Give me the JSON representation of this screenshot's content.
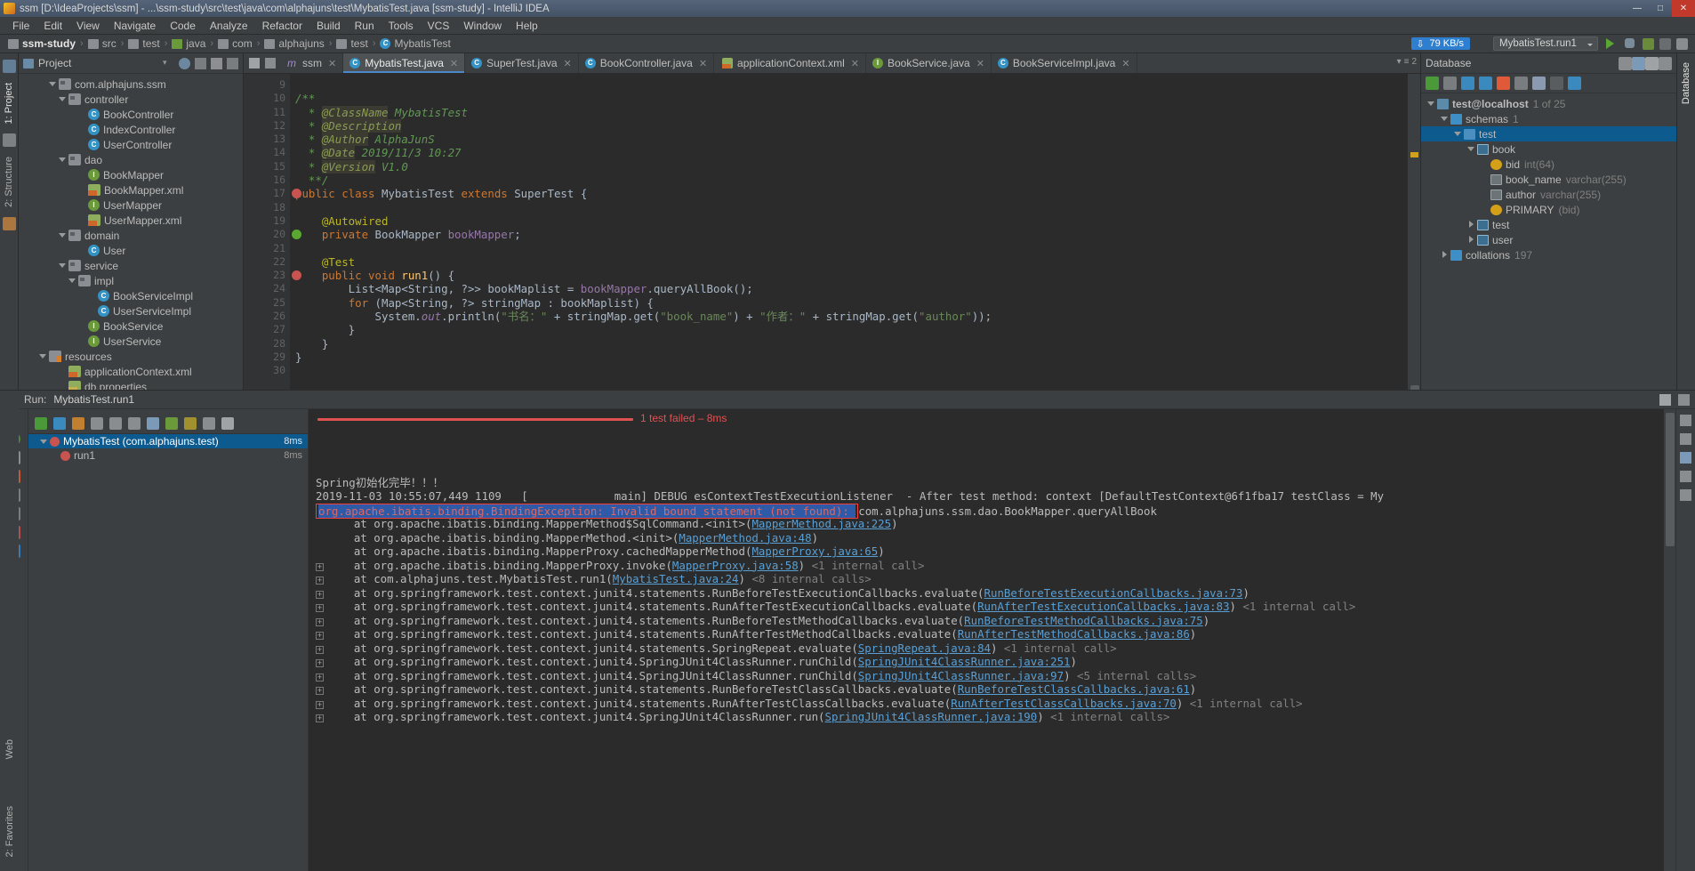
{
  "window": {
    "title": "ssm [D:\\IdeaProjects\\ssm] - ...\\ssm-study\\src\\test\\java\\com\\alphajuns\\test\\MybatisTest.java [ssm-study] - IntelliJ IDEA",
    "minimize": "—",
    "maximize": "□",
    "close": "✕"
  },
  "menubar": {
    "items": [
      "File",
      "Edit",
      "View",
      "Navigate",
      "Code",
      "Analyze",
      "Refactor",
      "Build",
      "Run",
      "Tools",
      "VCS",
      "Window",
      "Help"
    ]
  },
  "breadcrumb": {
    "items": [
      {
        "label": "ssm-study",
        "icon": "module-icon"
      },
      {
        "label": "src",
        "icon": "folder-icon"
      },
      {
        "label": "test",
        "icon": "folder-icon"
      },
      {
        "label": "java",
        "icon": "source-folder-icon"
      },
      {
        "label": "com",
        "icon": "package-icon"
      },
      {
        "label": "alphajuns",
        "icon": "package-icon"
      },
      {
        "label": "test",
        "icon": "package-icon"
      },
      {
        "label": "MybatisTest",
        "icon": "class-icon"
      }
    ]
  },
  "toolbar_right": {
    "network_badge": "79 KB/s",
    "run_config": "MybatisTest.run1"
  },
  "left_strip": {
    "tabs": [
      "1: Project",
      "2: Structure"
    ],
    "bottom_tabs": [
      "Web",
      "2: Favorites"
    ]
  },
  "right_strip": {
    "tabs": [
      "Database"
    ]
  },
  "project_panel": {
    "title": "Project",
    "tree": [
      {
        "label": "com.alphajuns.ssm",
        "indent": 3,
        "arrow": "down",
        "icon": "package-icon"
      },
      {
        "label": "controller",
        "indent": 4,
        "arrow": "down",
        "icon": "package-icon"
      },
      {
        "label": "BookController",
        "indent": 6,
        "arrow": "none",
        "icon": "class-icon"
      },
      {
        "label": "IndexController",
        "indent": 6,
        "arrow": "none",
        "icon": "class-icon"
      },
      {
        "label": "UserController",
        "indent": 6,
        "arrow": "none",
        "icon": "class-icon"
      },
      {
        "label": "dao",
        "indent": 4,
        "arrow": "down",
        "icon": "package-icon"
      },
      {
        "label": "BookMapper",
        "indent": 6,
        "arrow": "none",
        "icon": "interface-icon"
      },
      {
        "label": "BookMapper.xml",
        "indent": 6,
        "arrow": "none",
        "icon": "xml-icon"
      },
      {
        "label": "UserMapper",
        "indent": 6,
        "arrow": "none",
        "icon": "interface-icon"
      },
      {
        "label": "UserMapper.xml",
        "indent": 6,
        "arrow": "none",
        "icon": "xml-icon"
      },
      {
        "label": "domain",
        "indent": 4,
        "arrow": "down",
        "icon": "package-icon"
      },
      {
        "label": "User",
        "indent": 6,
        "arrow": "none",
        "icon": "class-icon"
      },
      {
        "label": "service",
        "indent": 4,
        "arrow": "down",
        "icon": "package-icon"
      },
      {
        "label": "impl",
        "indent": 5,
        "arrow": "down",
        "icon": "package-icon"
      },
      {
        "label": "BookServiceImpl",
        "indent": 7,
        "arrow": "none",
        "icon": "class-icon"
      },
      {
        "label": "UserServiceImpl",
        "indent": 7,
        "arrow": "none",
        "icon": "class-icon"
      },
      {
        "label": "BookService",
        "indent": 6,
        "arrow": "none",
        "icon": "interface-icon"
      },
      {
        "label": "UserService",
        "indent": 6,
        "arrow": "none",
        "icon": "interface-icon"
      },
      {
        "label": "resources",
        "indent": 2,
        "arrow": "down",
        "icon": "resource-folder-icon"
      },
      {
        "label": "applicationContext.xml",
        "indent": 4,
        "arrow": "none",
        "icon": "xml-icon"
      },
      {
        "label": "db.properties",
        "indent": 4,
        "arrow": "none",
        "icon": "properties-icon"
      }
    ]
  },
  "editor": {
    "tabs": [
      {
        "label": "ssm",
        "icon": "module-icon",
        "active": false,
        "closable": true
      },
      {
        "label": "MybatisTest.java",
        "icon": "class-icon",
        "active": true,
        "closable": true
      },
      {
        "label": "SuperTest.java",
        "icon": "class-icon",
        "active": false,
        "closable": true
      },
      {
        "label": "BookController.java",
        "icon": "class-icon",
        "active": false,
        "closable": true
      },
      {
        "label": "applicationContext.xml",
        "icon": "xml-icon",
        "active": false,
        "closable": true
      },
      {
        "label": "BookService.java",
        "icon": "interface-icon",
        "active": false,
        "closable": true
      },
      {
        "label": "BookServiceImpl.java",
        "icon": "class-icon",
        "active": false,
        "closable": true
      }
    ],
    "tab_overflow_count": "2",
    "line_numbers": [
      "9",
      "10",
      "11",
      "12",
      "13",
      "14",
      "15",
      "16",
      "17",
      "18",
      "19",
      "20",
      "21",
      "22",
      "23",
      "24",
      "25",
      "26",
      "27",
      "28",
      "29",
      "30"
    ],
    "code_lines": [
      {
        "n": "9",
        "html": ""
      },
      {
        "n": "10",
        "html": "<span class=\"cm\">/**</span>"
      },
      {
        "n": "11",
        "html": "  <span class=\"cm\">* </span><span class=\"tag\">@ClassName</span><span class=\"cm\"> MybatisTest</span>"
      },
      {
        "n": "12",
        "html": "  <span class=\"cm\">* </span><span class=\"tag\">@Description</span>"
      },
      {
        "n": "13",
        "html": "  <span class=\"cm\">* </span><span class=\"tag\">@Author</span><span class=\"cm\"> AlphaJunS</span>"
      },
      {
        "n": "14",
        "html": "  <span class=\"cm\">* </span><span class=\"tag\">@Date</span><span class=\"cm\"> 2019/11/3 10:27</span>"
      },
      {
        "n": "15",
        "html": "  <span class=\"cm\">* </span><span class=\"tag\">@Version</span><span class=\"cm\"> V1.0</span>"
      },
      {
        "n": "16",
        "html": "  <span class=\"cm\">**/</span>"
      },
      {
        "n": "17",
        "html": "<span class=\"kw\">public class </span>MybatisTest <span class=\"kw\">extends </span>SuperTest <span class=\"brc\">{</span>"
      },
      {
        "n": "18",
        "html": ""
      },
      {
        "n": "19",
        "html": "    <span class=\"an\">@Autowired</span>"
      },
      {
        "n": "20",
        "html": "    <span class=\"kw\">private </span>BookMapper <span class=\"fld\">bookMapper</span>;"
      },
      {
        "n": "21",
        "html": ""
      },
      {
        "n": "22",
        "html": "    <span class=\"an\">@Test</span>"
      },
      {
        "n": "23",
        "html": "    <span class=\"kw\">public void </span><span class=\"mth\">run1</span>() {"
      },
      {
        "n": "24",
        "html": "        List&lt;Map&lt;String, ?&gt;&gt; bookMaplist = <span class=\"fld\">bookMapper</span>.queryAllBook();"
      },
      {
        "n": "25",
        "html": "        <span class=\"kw\">for </span>(Map&lt;String, ?&gt; stringMap : bookMaplist) {"
      },
      {
        "n": "26",
        "html": "            System.<span class=\"stat\">out</span>.println(<span class=\"str\">\"书名：\"</span> + stringMap.get(<span class=\"str\">\"book_name\"</span>) + <span class=\"str\">\"作者：\"</span> + stringMap.get(<span class=\"str\">\"author\"</span>));"
      },
      {
        "n": "27",
        "html": "        }"
      },
      {
        "n": "28",
        "html": "    }"
      },
      {
        "n": "29",
        "html": "<span class=\"brc\">}</span>"
      },
      {
        "n": "30",
        "html": ""
      }
    ],
    "status_breadcrumb": "MybatisTest"
  },
  "database_panel": {
    "title": "Database",
    "tree": [
      {
        "label": "test@localhost",
        "suffix": "1 of 25",
        "indent": 0,
        "arrow": "down",
        "icon": "datasource-icon",
        "bold": true
      },
      {
        "label": "schemas",
        "suffix": "1",
        "indent": 1,
        "arrow": "down",
        "icon": "folder-icon"
      },
      {
        "label": "test",
        "suffix": "",
        "indent": 2,
        "arrow": "down",
        "icon": "schema-icon",
        "selected": true
      },
      {
        "label": "book",
        "suffix": "",
        "indent": 3,
        "arrow": "down",
        "icon": "table-icon"
      },
      {
        "label": "bid",
        "suffix": "int(64)",
        "indent": 4,
        "arrow": "none",
        "icon": "key-column-icon"
      },
      {
        "label": "book_name",
        "suffix": "varchar(255)",
        "indent": 4,
        "arrow": "none",
        "icon": "column-icon"
      },
      {
        "label": "author",
        "suffix": "varchar(255)",
        "indent": 4,
        "arrow": "none",
        "icon": "column-icon"
      },
      {
        "label": "PRIMARY",
        "suffix": "(bid)",
        "indent": 4,
        "arrow": "none",
        "icon": "primary-key-icon"
      },
      {
        "label": "test",
        "suffix": "",
        "indent": 3,
        "arrow": "right",
        "icon": "table-icon"
      },
      {
        "label": "user",
        "suffix": "",
        "indent": 3,
        "arrow": "right",
        "icon": "table-icon"
      },
      {
        "label": "collations",
        "suffix": "197",
        "indent": 1,
        "arrow": "right",
        "icon": "folder-icon"
      }
    ]
  },
  "run_panel": {
    "title": "Run:",
    "config_name": "MybatisTest.run1",
    "test_tree": [
      {
        "label": "MybatisTest (com.alphajuns.test)",
        "time": "8ms",
        "indent": 1,
        "status": "fail",
        "selected": true,
        "arrow": "down"
      },
      {
        "label": "run1",
        "time": "8ms",
        "indent": 3,
        "status": "fail",
        "selected": false,
        "arrow": "none"
      }
    ],
    "progress_text": "1 test failed – 8ms",
    "console_lines": [
      {
        "type": "plain",
        "text": "Spring初始化完毕！！！"
      },
      {
        "type": "plain",
        "text": "2019-11-03 10:55:07,449 1109   [             main] DEBUG esContextTestExecutionListener  - After test method: context [DefaultTestContext@6f1fba17 testClass = My"
      },
      {
        "type": "error-highlight",
        "text": "org.apache.ibatis.binding.BindingException: Invalid bound statement (not found): ",
        "tail": "com.alphajuns.ssm.dao.BookMapper.queryAllBook"
      },
      {
        "type": "stack",
        "expand": false,
        "pre": "    at org.apache.ibatis.binding.MapperMethod$SqlCommand.<init>(",
        "link": "MapperMethod.java:225",
        "post": ")",
        "note": ""
      },
      {
        "type": "stack",
        "expand": false,
        "pre": "    at org.apache.ibatis.binding.MapperMethod.<init>(",
        "link": "MapperMethod.java:48",
        "post": ")",
        "note": ""
      },
      {
        "type": "stack",
        "expand": false,
        "pre": "    at org.apache.ibatis.binding.MapperProxy.cachedMapperMethod(",
        "link": "MapperProxy.java:65",
        "post": ")",
        "note": ""
      },
      {
        "type": "stack",
        "expand": true,
        "pre": "    at org.apache.ibatis.binding.MapperProxy.invoke(",
        "link": "MapperProxy.java:58",
        "post": ")",
        "note": "<1 internal call>"
      },
      {
        "type": "stack",
        "expand": true,
        "pre": "    at com.alphajuns.test.MybatisTest.run1(",
        "link": "MybatisTest.java:24",
        "post": ")",
        "note": "<8 internal calls>"
      },
      {
        "type": "stack",
        "expand": true,
        "pre": "    at org.springframework.test.context.junit4.statements.RunBeforeTestExecutionCallbacks.evaluate(",
        "link": "RunBeforeTestExecutionCallbacks.java:73",
        "post": ")",
        "note": ""
      },
      {
        "type": "stack",
        "expand": true,
        "pre": "    at org.springframework.test.context.junit4.statements.RunAfterTestExecutionCallbacks.evaluate(",
        "link": "RunAfterTestExecutionCallbacks.java:83",
        "post": ")",
        "note": "<1 internal call>"
      },
      {
        "type": "stack",
        "expand": true,
        "pre": "    at org.springframework.test.context.junit4.statements.RunBeforeTestMethodCallbacks.evaluate(",
        "link": "RunBeforeTestMethodCallbacks.java:75",
        "post": ")",
        "note": ""
      },
      {
        "type": "stack",
        "expand": true,
        "pre": "    at org.springframework.test.context.junit4.statements.RunAfterTestMethodCallbacks.evaluate(",
        "link": "RunAfterTestMethodCallbacks.java:86",
        "post": ")",
        "note": ""
      },
      {
        "type": "stack",
        "expand": true,
        "pre": "    at org.springframework.test.context.junit4.statements.SpringRepeat.evaluate(",
        "link": "SpringRepeat.java:84",
        "post": ")",
        "note": "<1 internal call>"
      },
      {
        "type": "stack",
        "expand": true,
        "pre": "    at org.springframework.test.context.junit4.SpringJUnit4ClassRunner.runChild(",
        "link": "SpringJUnit4ClassRunner.java:251",
        "post": ")",
        "note": ""
      },
      {
        "type": "stack",
        "expand": true,
        "pre": "    at org.springframework.test.context.junit4.SpringJUnit4ClassRunner.runChild(",
        "link": "SpringJUnit4ClassRunner.java:97",
        "post": ")",
        "note": "<5 internal calls>"
      },
      {
        "type": "stack",
        "expand": true,
        "pre": "    at org.springframework.test.context.junit4.statements.RunBeforeTestClassCallbacks.evaluate(",
        "link": "RunBeforeTestClassCallbacks.java:61",
        "post": ")",
        "note": ""
      },
      {
        "type": "stack",
        "expand": true,
        "pre": "    at org.springframework.test.context.junit4.statements.RunAfterTestClassCallbacks.evaluate(",
        "link": "RunAfterTestClassCallbacks.java:70",
        "post": ")",
        "note": "<1 internal call>"
      },
      {
        "type": "stack",
        "expand": true,
        "pre": "    at org.springframework.test.context.junit4.SpringJUnit4ClassRunner.run(",
        "link": "SpringJUnit4ClassRunner.java:190",
        "post": ")",
        "note": "<1 internal calls>"
      }
    ]
  },
  "colors": {
    "accent_blue": "#4a88c7",
    "error_red": "#e05252",
    "selection_blue": "#0d5a8f",
    "panel_bg": "#3c3f41",
    "editor_bg": "#2b2b2b"
  }
}
